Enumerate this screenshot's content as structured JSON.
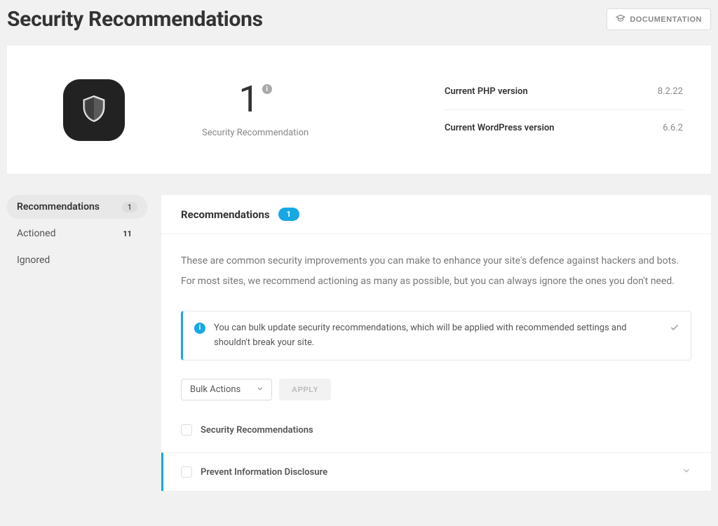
{
  "header": {
    "title": "Security Recommendations",
    "doc_button": "DOCUMENTATION"
  },
  "summary": {
    "count": "1",
    "count_label": "Security Recommendation",
    "versions": [
      {
        "label": "Current PHP version",
        "value": "8.2.22"
      },
      {
        "label": "Current WordPress version",
        "value": "6.6.2"
      }
    ]
  },
  "sidebar": {
    "items": [
      {
        "label": "Recommendations",
        "count": "1",
        "active": true
      },
      {
        "label": "Actioned",
        "count": "11",
        "active": false
      },
      {
        "label": "Ignored",
        "count": "",
        "active": false
      }
    ]
  },
  "panel": {
    "title": "Recommendations",
    "badge": "1",
    "intro": "These are common security improvements you can make to enhance your site's defence against hackers and bots. For most sites, we recommend actioning as many as possible, but you can always ignore the ones you don't need.",
    "notice": "You can bulk update security recommendations, which will be applied with recommended settings and shouldn't break your site.",
    "bulk": {
      "select_label": "Bulk Actions",
      "apply_label": "APPLY"
    },
    "select_all_label": "Security Recommendations",
    "items": [
      {
        "title": "Prevent Information Disclosure"
      }
    ]
  }
}
